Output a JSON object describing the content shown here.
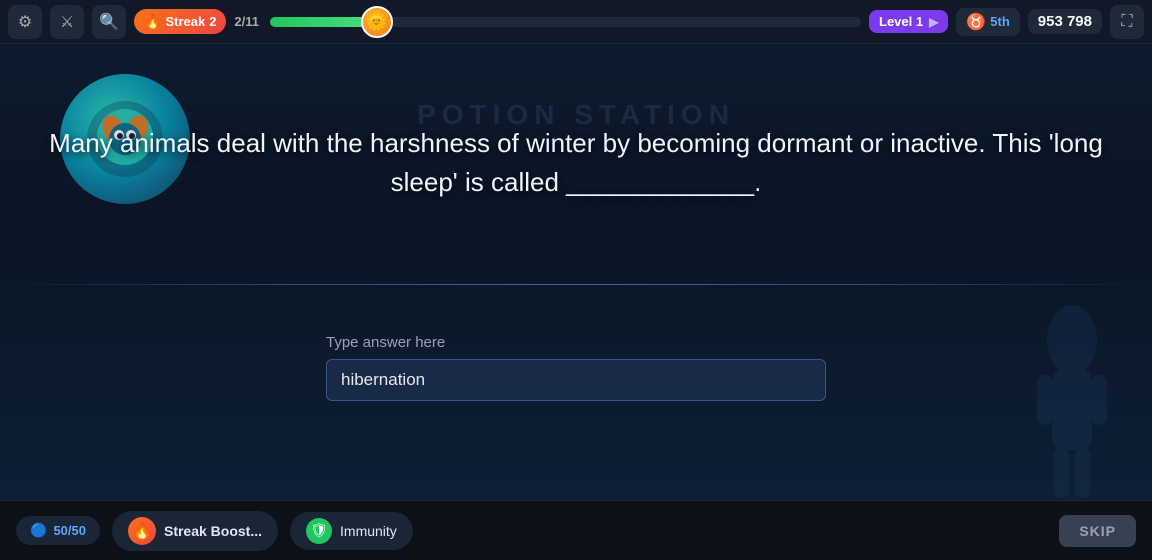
{
  "topbar": {
    "settings_icon": "⚙",
    "swords_icon": "⚔",
    "search_icon": "🔍",
    "streak_label": "Streak",
    "streak_count": "2",
    "progress_fraction": "2/11",
    "progress_percent": 18,
    "level_label": "Level 1",
    "rank_label": "5th",
    "score": "953 798",
    "fullscreen_icon": "⛶"
  },
  "main": {
    "bg_station": "POTION STATION",
    "question": "Many animals deal with the harshness of winter by becoming dormant or inactive. This 'long sleep' is called _____________.",
    "answer_label": "Type answer here",
    "answer_value": "hibernation"
  },
  "bottombar": {
    "power_count": "50/50",
    "streak_boost_label": "Streak Boost...",
    "immunity_label": "Immunity",
    "skip_label": "SKIP"
  }
}
